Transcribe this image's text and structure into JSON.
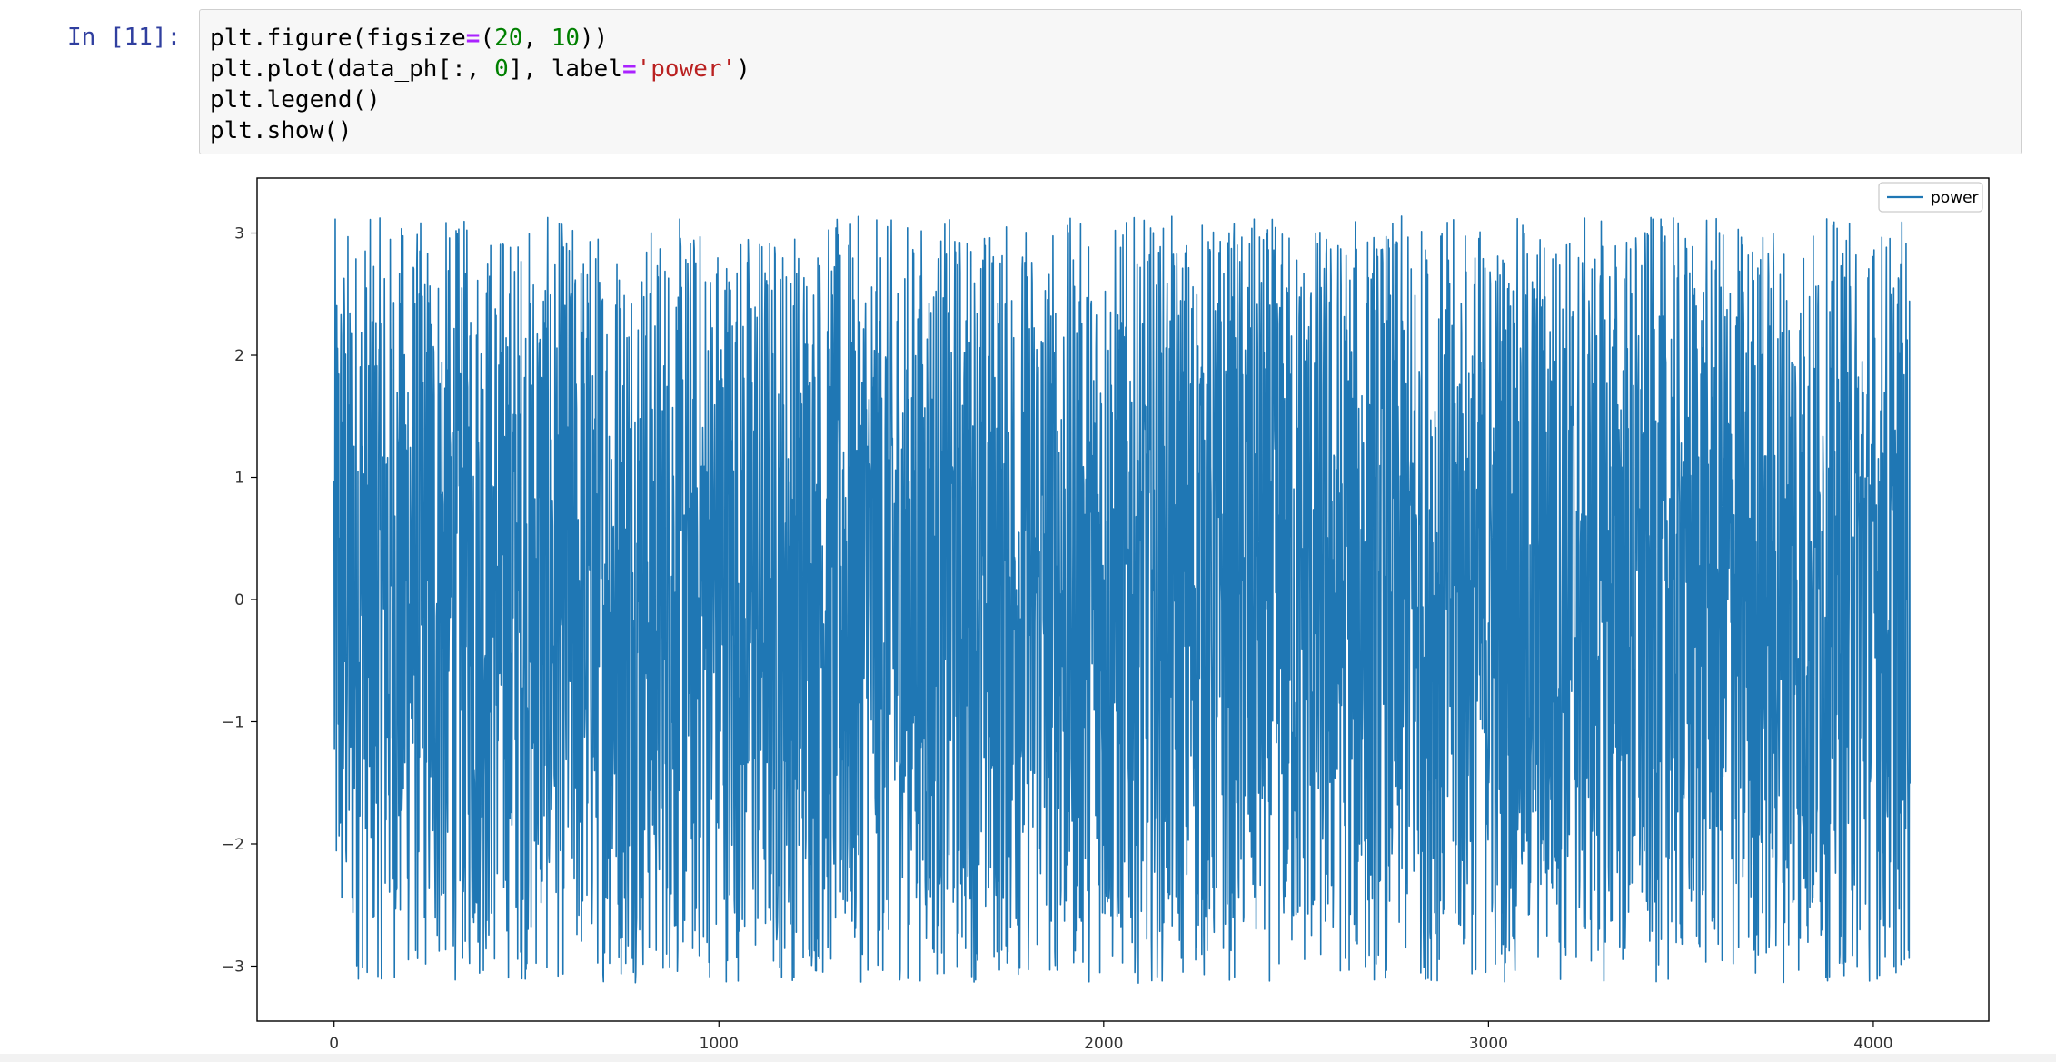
{
  "cell": {
    "prompt": "In [11]:",
    "code_lines": [
      [
        {
          "t": "plt.figure(figsize",
          "c": ""
        },
        {
          "t": "=",
          "c": "kw-op"
        },
        {
          "t": "(",
          "c": ""
        },
        {
          "t": "20",
          "c": "num"
        },
        {
          "t": ", ",
          "c": ""
        },
        {
          "t": "10",
          "c": "num"
        },
        {
          "t": "))",
          "c": ""
        }
      ],
      [
        {
          "t": "plt.plot(data_ph[:, ",
          "c": ""
        },
        {
          "t": "0",
          "c": "num"
        },
        {
          "t": "], label",
          "c": ""
        },
        {
          "t": "=",
          "c": "kw-op"
        },
        {
          "t": "'power'",
          "c": "str"
        },
        {
          "t": ")",
          "c": ""
        }
      ],
      [
        {
          "t": "plt.legend()",
          "c": ""
        }
      ],
      [
        {
          "t": "plt.show()",
          "c": ""
        }
      ]
    ]
  },
  "chart_data": {
    "type": "line",
    "title": "",
    "xlabel": "",
    "ylabel": "",
    "xlim": [
      -200,
      4300
    ],
    "ylim": [
      -3.45,
      3.45
    ],
    "x_ticks": [
      0,
      1000,
      2000,
      3000,
      4000
    ],
    "y_ticks": [
      3,
      2,
      1,
      0,
      -1,
      -2,
      -3
    ],
    "x_tick_labels": [
      "0",
      "1000",
      "2000",
      "3000",
      "4000"
    ],
    "y_tick_labels": [
      "3",
      "2",
      "1",
      "0",
      "−1",
      "−2",
      "−3"
    ],
    "legend": {
      "placement": "top-right",
      "entries": [
        "power"
      ]
    },
    "grid": false,
    "series": [
      {
        "name": "power",
        "color": "#1f77b4",
        "x_start": 0,
        "x_end": 4095,
        "n_points": 4096,
        "y_range": [
          -3.14,
          3.14
        ],
        "distribution": "uniform random phase values between -π and π"
      }
    ]
  }
}
